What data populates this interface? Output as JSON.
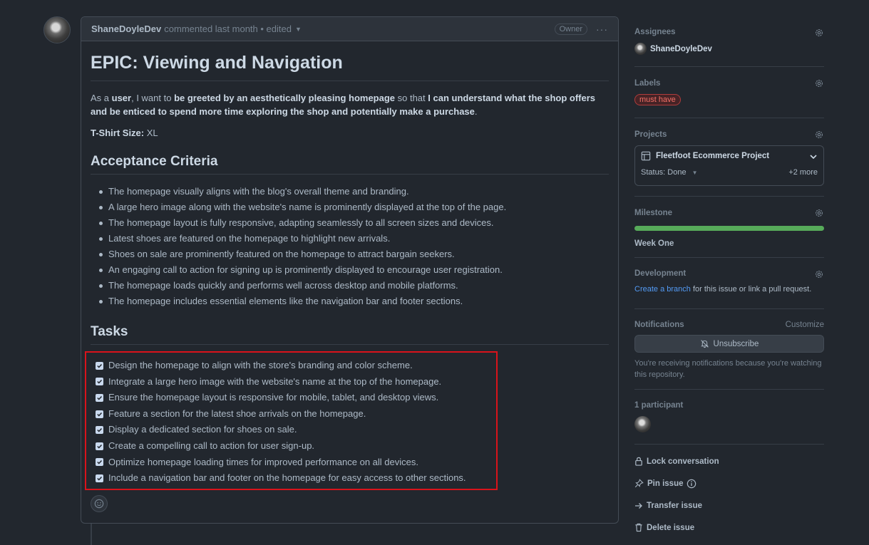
{
  "comment": {
    "author": "ShaneDoyleDev",
    "meta": "commented last month • edited",
    "owner_badge": "Owner",
    "menu": "···"
  },
  "body": {
    "title": "EPIC: Viewing and Navigation",
    "story": {
      "p1": "As a ",
      "b1": "user",
      "p2": ", I want to ",
      "b2": "be greeted by an aesthetically pleasing homepage",
      "p3": " so that ",
      "b3": "I can understand what the shop offers and be enticed to spend more time exploring the shop and potentially make a purchase",
      "p4": "."
    },
    "tshirt_label": "T-Shirt Size:",
    "tshirt_value": " XL",
    "acceptance_heading": "Acceptance Criteria",
    "criteria": [
      "The homepage visually aligns with the blog's overall theme and branding.",
      "A large hero image along with the website's name is prominently displayed at the top of the page.",
      "The homepage layout is fully responsive, adapting seamlessly to all screen sizes and devices.",
      "Latest shoes are featured on the homepage to highlight new arrivals.",
      "Shoes on sale are prominently featured on the homepage to attract bargain seekers.",
      "An engaging call to action for signing up is prominently displayed to encourage user registration.",
      "The homepage loads quickly and performs well across desktop and mobile platforms.",
      "The homepage includes essential elements like the navigation bar and footer sections."
    ],
    "tasks_heading": "Tasks",
    "tasks": [
      "Design the homepage to align with the store's branding and color scheme.",
      "Integrate a large hero image with the website's name at the top of the homepage.",
      "Ensure the homepage layout is responsive for mobile, tablet, and desktop views.",
      "Feature a section for the latest shoe arrivals on the homepage.",
      "Display a dedicated section for shoes on sale.",
      "Create a compelling call to action for user sign-up.",
      "Optimize homepage loading times for improved performance on all devices.",
      "Include a navigation bar and footer on the homepage for easy access to other sections."
    ]
  },
  "sidebar": {
    "assignees_title": "Assignees",
    "assignee": "ShaneDoyleDev",
    "labels_title": "Labels",
    "label": "must have",
    "projects_title": "Projects",
    "project_name": "Fleetfoot Ecommerce Project",
    "project_status": "Status: Done",
    "project_more": "+2 more",
    "milestone_title": "Milestone",
    "milestone_progress": 1.0,
    "milestone_name": "Week One",
    "development_title": "Development",
    "dev_link": "Create a branch",
    "dev_rest": " for this issue or link a pull request.",
    "notifications_title": "Notifications",
    "customize": "Customize",
    "unsubscribe": "Unsubscribe",
    "notif_text": "You're receiving notifications because you're watching this repository.",
    "participants_title": "1 participant",
    "lock": "Lock conversation",
    "pin": "Pin issue",
    "transfer": "Transfer issue",
    "delete": "Delete issue"
  },
  "colors": {
    "highlight_box": "#d9131b",
    "label_text": "#f47067",
    "milestone_bar": "#57ab5a",
    "link": "#539bf5"
  }
}
